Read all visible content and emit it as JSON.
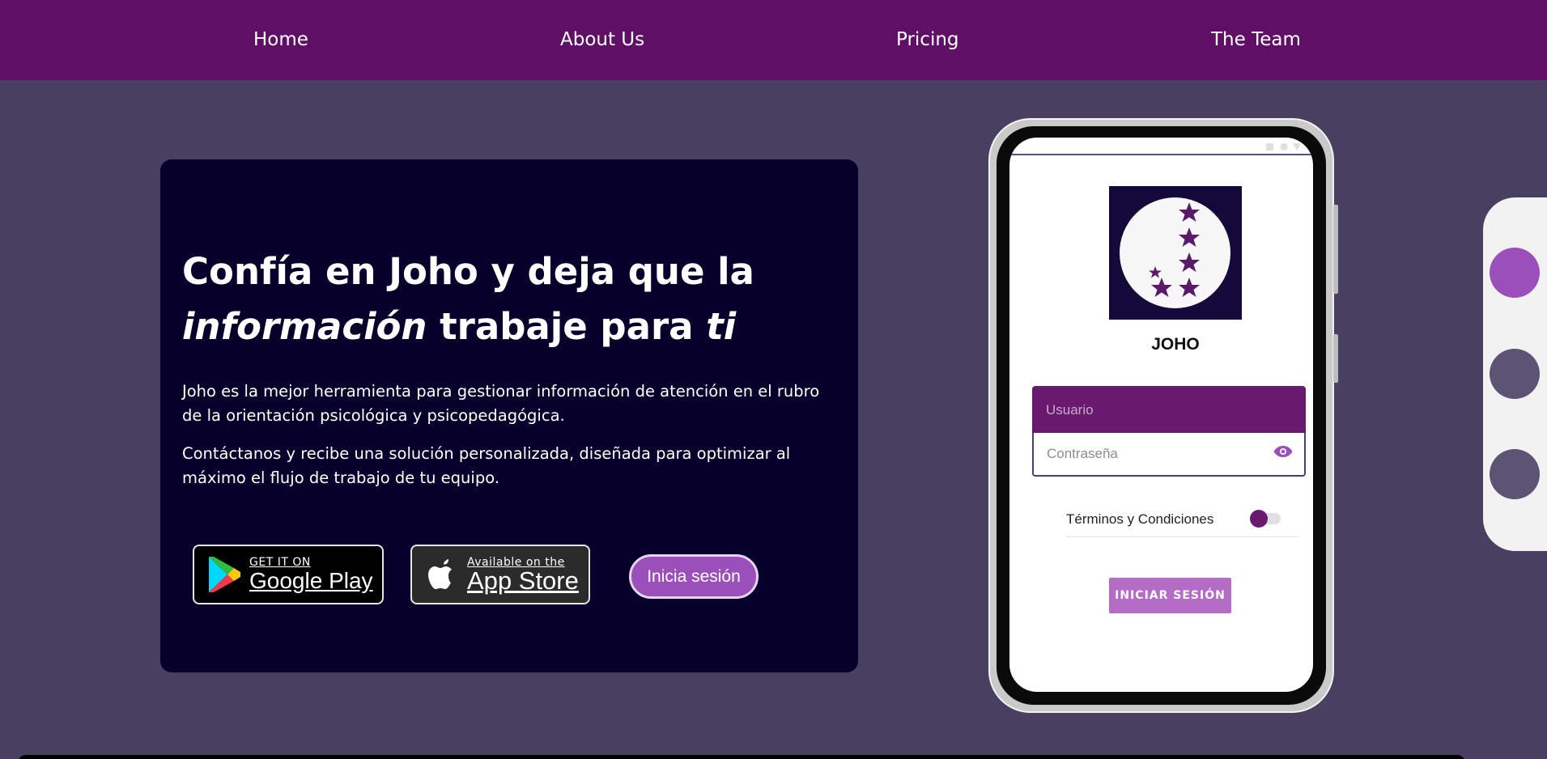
{
  "nav": {
    "items": [
      {
        "label": "Home"
      },
      {
        "label": "About Us"
      },
      {
        "label": "Pricing"
      },
      {
        "label": "The Team"
      }
    ]
  },
  "hero": {
    "title_part1": "Confía en Joho y deja que la ",
    "title_em1": "información",
    "title_part2": " trabaje para ",
    "title_em2": "ti",
    "paragraph1": "Joho es la mejor herramienta para gestionar información de atención en el rubro de la orientación psicológica y psicopedagógica.",
    "paragraph2": "Contáctanos y recibe una solución personalizada, diseñada para optimizar al máximo el flujo de trabajo de tu equipo.",
    "google_play_small": "GET IT ON",
    "google_play_big": "Google Play",
    "app_store_small": "Available on the",
    "app_store_big": "App Store",
    "login_button": "Inicia sesión"
  },
  "phone": {
    "brand": "JOHO",
    "username_placeholder": "Usuario",
    "password_placeholder": "Contraseña",
    "terms_label": "Términos y Condiciones",
    "terms_accepted": true,
    "submit_button": "INICIAR SESIÓN"
  },
  "carousel": {
    "active_index": 0,
    "dot_count": 3
  },
  "colors": {
    "nav_bg": "#600f66",
    "page_bg": "#474060",
    "hero_bg": "#07002a",
    "accent": "#9b4fb8",
    "dot_active": "#9b4fb8",
    "dot_inactive": "#5b5475"
  }
}
